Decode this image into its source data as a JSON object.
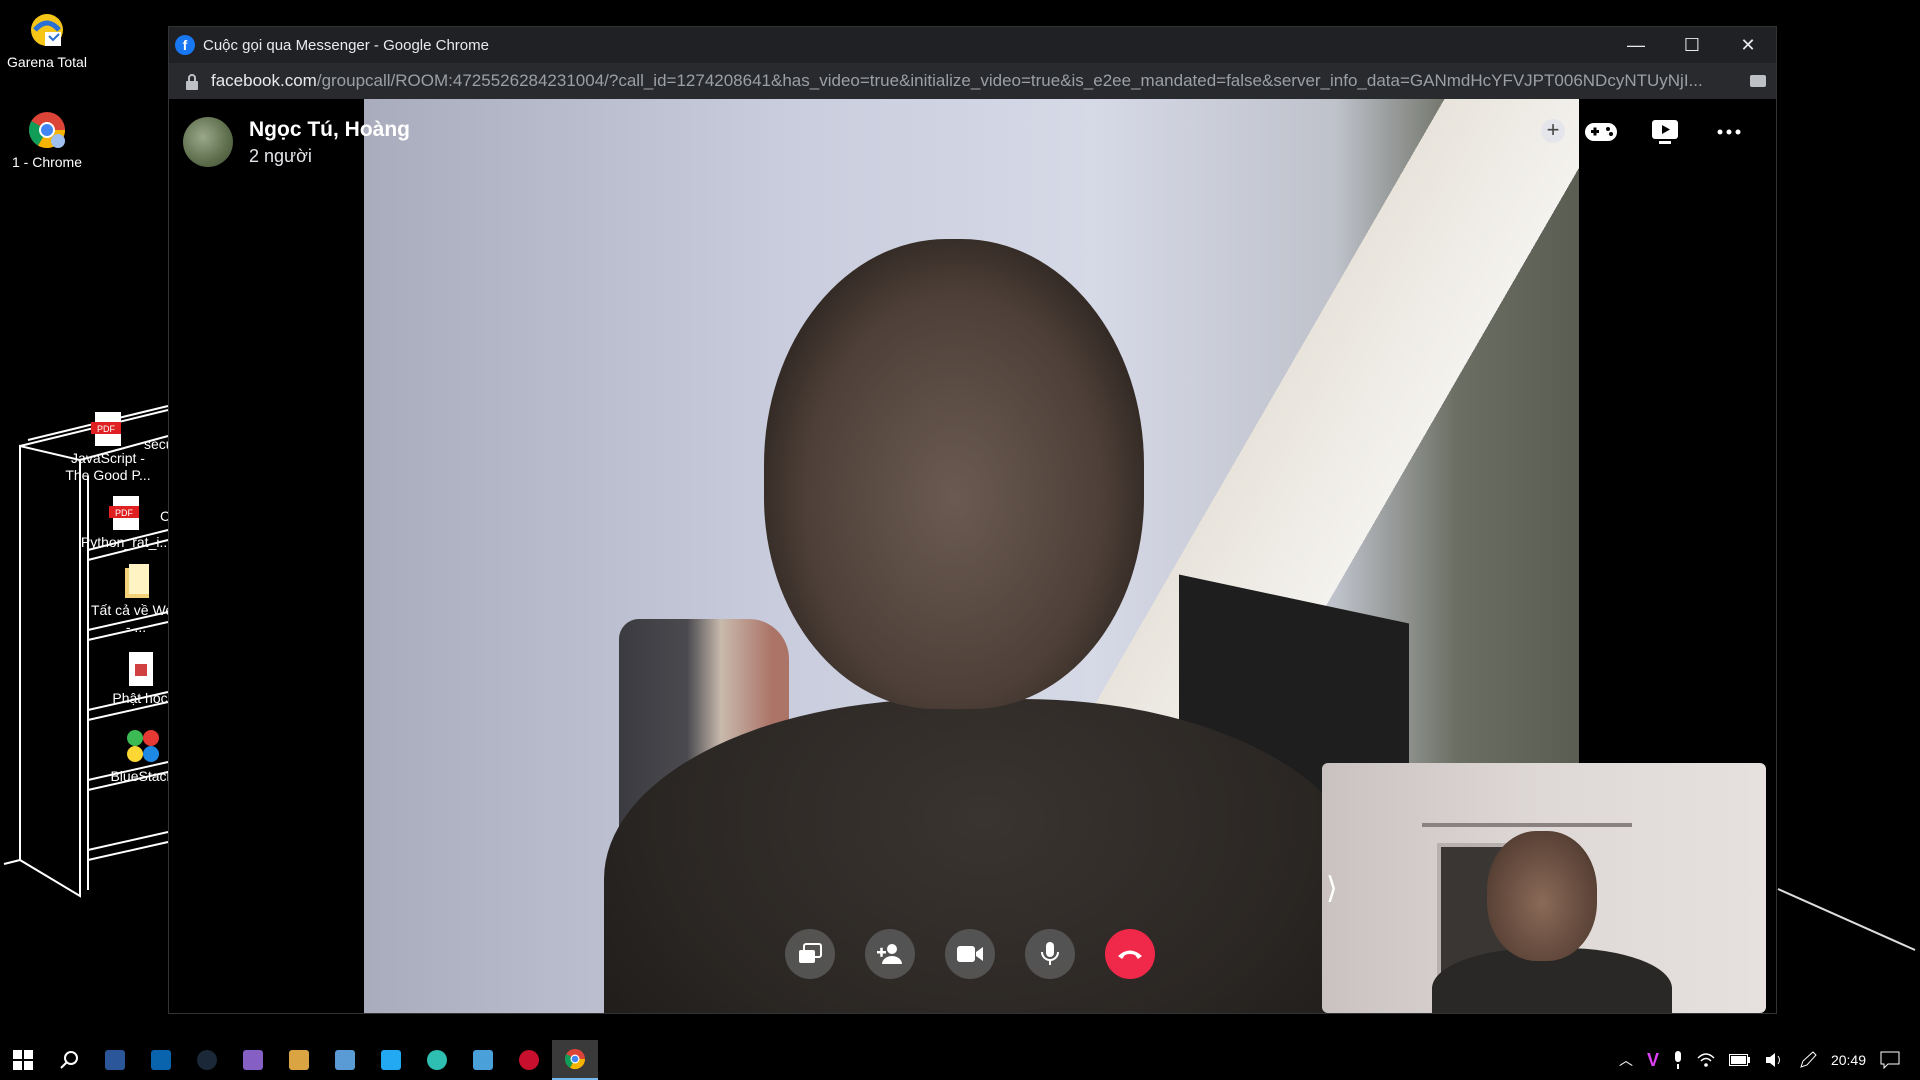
{
  "desktop": {
    "icons": [
      {
        "label": "Garena Total"
      },
      {
        "label": "1 - Chrome"
      }
    ],
    "shelf_items": [
      {
        "label": "JavaScript - The Good P...",
        "type": "PDF",
        "extra": "secu"
      },
      {
        "label": "Python_rat_i...",
        "type": "PDF",
        "extra": "C"
      },
      {
        "label": "Tất cả về Web - ..."
      },
      {
        "label": "Phật học"
      },
      {
        "label": "BlueStack"
      }
    ]
  },
  "window": {
    "title": "Cuộc gọi qua Messenger - Google Chrome",
    "minimize": "—",
    "maximize": "☐",
    "close": "✕",
    "url_domain": "facebook.com",
    "url_path": "/groupcall/ROOM:4725526284231004/?call_id=1274208641&has_video=true&initialize_video=true&is_e2ee_mandated=false&server_info_data=GANmdHcYFVJPT006NDcyNTUyNjI..."
  },
  "call": {
    "caller_name": "Ngọc Tú, Hoàng",
    "participants": "2 người",
    "plus_symbol": "+",
    "top_actions": [
      "add-icon",
      "game-icon",
      "watch-together-icon",
      "more-icon"
    ],
    "controls": [
      "share-screen",
      "add-person",
      "video",
      "microphone",
      "end-call"
    ],
    "selfview_toggle": "⟩"
  },
  "taskbar": {
    "pinned": [
      "start",
      "search",
      "word",
      "mail",
      "steam",
      "visual-studio",
      "app",
      "outlook",
      "vscode",
      "edge",
      "app2",
      "app3",
      "chrome"
    ],
    "clock": "20:49"
  },
  "colors": {
    "facebook_blue": "#1877f2",
    "end_call_red": "#f02849",
    "titlebar": "#202124",
    "addressbar": "#292a2d"
  }
}
